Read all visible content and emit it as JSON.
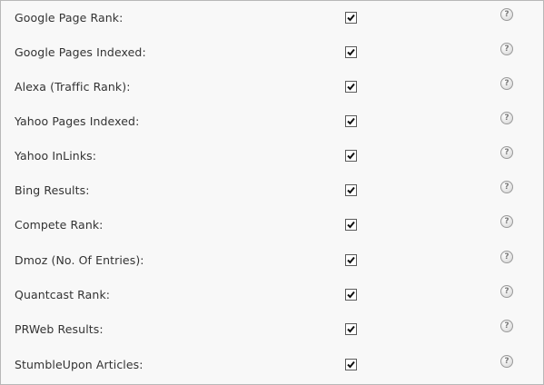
{
  "settings": {
    "rows": [
      {
        "label": "Google Page Rank:",
        "checked": true,
        "help_icon": "question-circle-icon"
      },
      {
        "label": "Google Pages Indexed:",
        "checked": true,
        "help_icon": "question-circle-icon"
      },
      {
        "label": "Alexa (Traffic Rank):",
        "checked": true,
        "help_icon": "question-circle-icon"
      },
      {
        "label": "Yahoo Pages Indexed:",
        "checked": true,
        "help_icon": "question-circle-icon"
      },
      {
        "label": "Yahoo InLinks:",
        "checked": true,
        "help_icon": "question-circle-icon"
      },
      {
        "label": "Bing Results:",
        "checked": true,
        "help_icon": "question-circle-icon"
      },
      {
        "label": "Compete Rank:",
        "checked": true,
        "help_icon": "question-circle-icon"
      },
      {
        "label": "Dmoz (No. Of Entries):",
        "checked": true,
        "help_icon": "question-circle-icon"
      },
      {
        "label": "Quantcast Rank:",
        "checked": true,
        "help_icon": "question-circle-icon"
      },
      {
        "label": "PRWeb Results:",
        "checked": true,
        "help_icon": "question-circle-icon"
      },
      {
        "label": "StumbleUpon Articles:",
        "checked": true,
        "help_icon": "question-circle-icon"
      }
    ],
    "help_glyph": "?"
  },
  "colors": {
    "background": "#f8f8f8",
    "border": "#b8b8b8",
    "text": "#333333",
    "checkmark": "#111111"
  }
}
